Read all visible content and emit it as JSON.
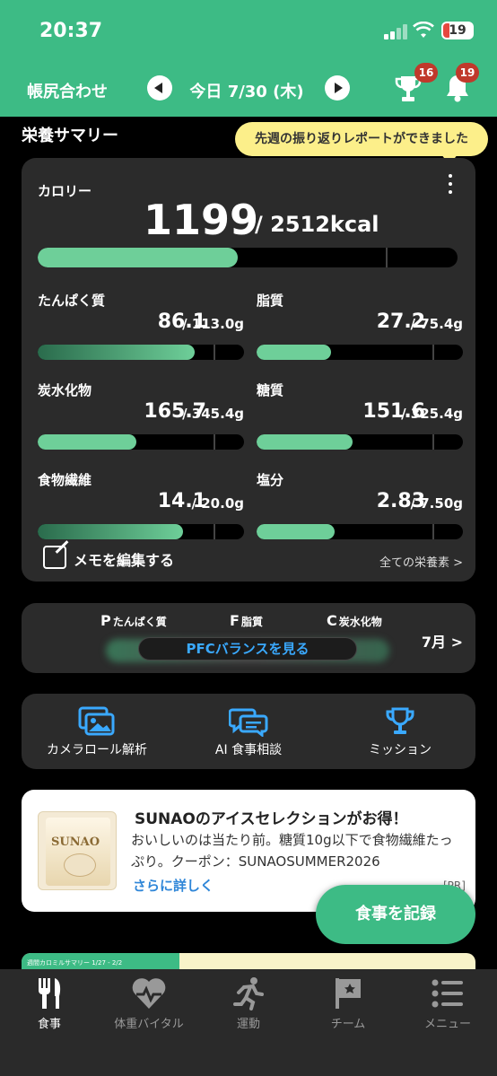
{
  "status_bar": {
    "time": "20:37",
    "battery": "19"
  },
  "header": {
    "left_label": "帳尻合わせ",
    "date_label": "今日 7/30 (木)",
    "trophy_badge": "16",
    "bell_badge": "19"
  },
  "summary": {
    "title": "栄養サマリー",
    "tooltip": "先週の振り返りレポートができました"
  },
  "calories": {
    "label": "カロリー",
    "value": "1199",
    "goal": "/ 2512kcal",
    "progress": 0.4773
  },
  "nutrients": [
    {
      "name": "たんぱく質",
      "value": "86.1",
      "goal": "/ 113.0g",
      "progress": 0.762
    },
    {
      "name": "脂質",
      "value": "27.2",
      "goal": "/ 75.4g",
      "progress": 0.361
    },
    {
      "name": "炭水化物",
      "value": "165.7",
      "goal": "/ 345.4g",
      "progress": 0.48
    },
    {
      "name": "糖質",
      "value": "151.6",
      "goal": "/ 325.4g",
      "progress": 0.466
    },
    {
      "name": "食物繊維",
      "value": "14.1",
      "goal": "/ 20.0g",
      "progress": 0.705
    },
    {
      "name": "塩分",
      "value": "2.83",
      "goal": "/ 7.50g",
      "progress": 0.377
    }
  ],
  "memo": {
    "label": "メモを編集する",
    "all_nutrients": "全ての栄養素 >"
  },
  "pfc": {
    "p_letter": "P",
    "p_label": "たんぱく質",
    "f_letter": "F",
    "f_label": "脂質",
    "c_letter": "C",
    "c_label": "炭水化物",
    "button": "PFCバランスを見る",
    "month": "7月 >"
  },
  "actions": [
    {
      "label": "カメラロール解析",
      "icon": "photo-gallery-icon"
    },
    {
      "label": "AI 食事相談",
      "icon": "chat-bubbles-icon"
    },
    {
      "label": "ミッション",
      "icon": "trophy-icon"
    }
  ],
  "ad": {
    "title": "SUNAOのアイスセレクションがお得！",
    "body": "おいしいのは当たり前。糖質10g以下で食物繊維たっぷり。クーポン：SUNAOSUMMER2026",
    "link": "さらに詳しく",
    "pr": "[PR]",
    "image_brand": "SUNAO"
  },
  "record_button": "食事を記録",
  "bottom_banner": "週間カロミルサマリー 1/27 - 2/2",
  "tabs": [
    {
      "label": "食事",
      "icon": "fork-knife-icon",
      "active": true
    },
    {
      "label": "体重バイタル",
      "icon": "heart-pulse-icon",
      "active": false
    },
    {
      "label": "運動",
      "icon": "running-icon",
      "active": false
    },
    {
      "label": "チーム",
      "icon": "flag-icon",
      "active": false
    },
    {
      "label": "メニュー",
      "icon": "menu-list-icon",
      "active": false
    }
  ],
  "colors": {
    "brand_green": "#3dbb85",
    "bar_green": "#6ecf99",
    "tooltip_yellow": "#fcef8a",
    "link_blue": "#3aa9ff",
    "badge_red": "#c0392b"
  }
}
